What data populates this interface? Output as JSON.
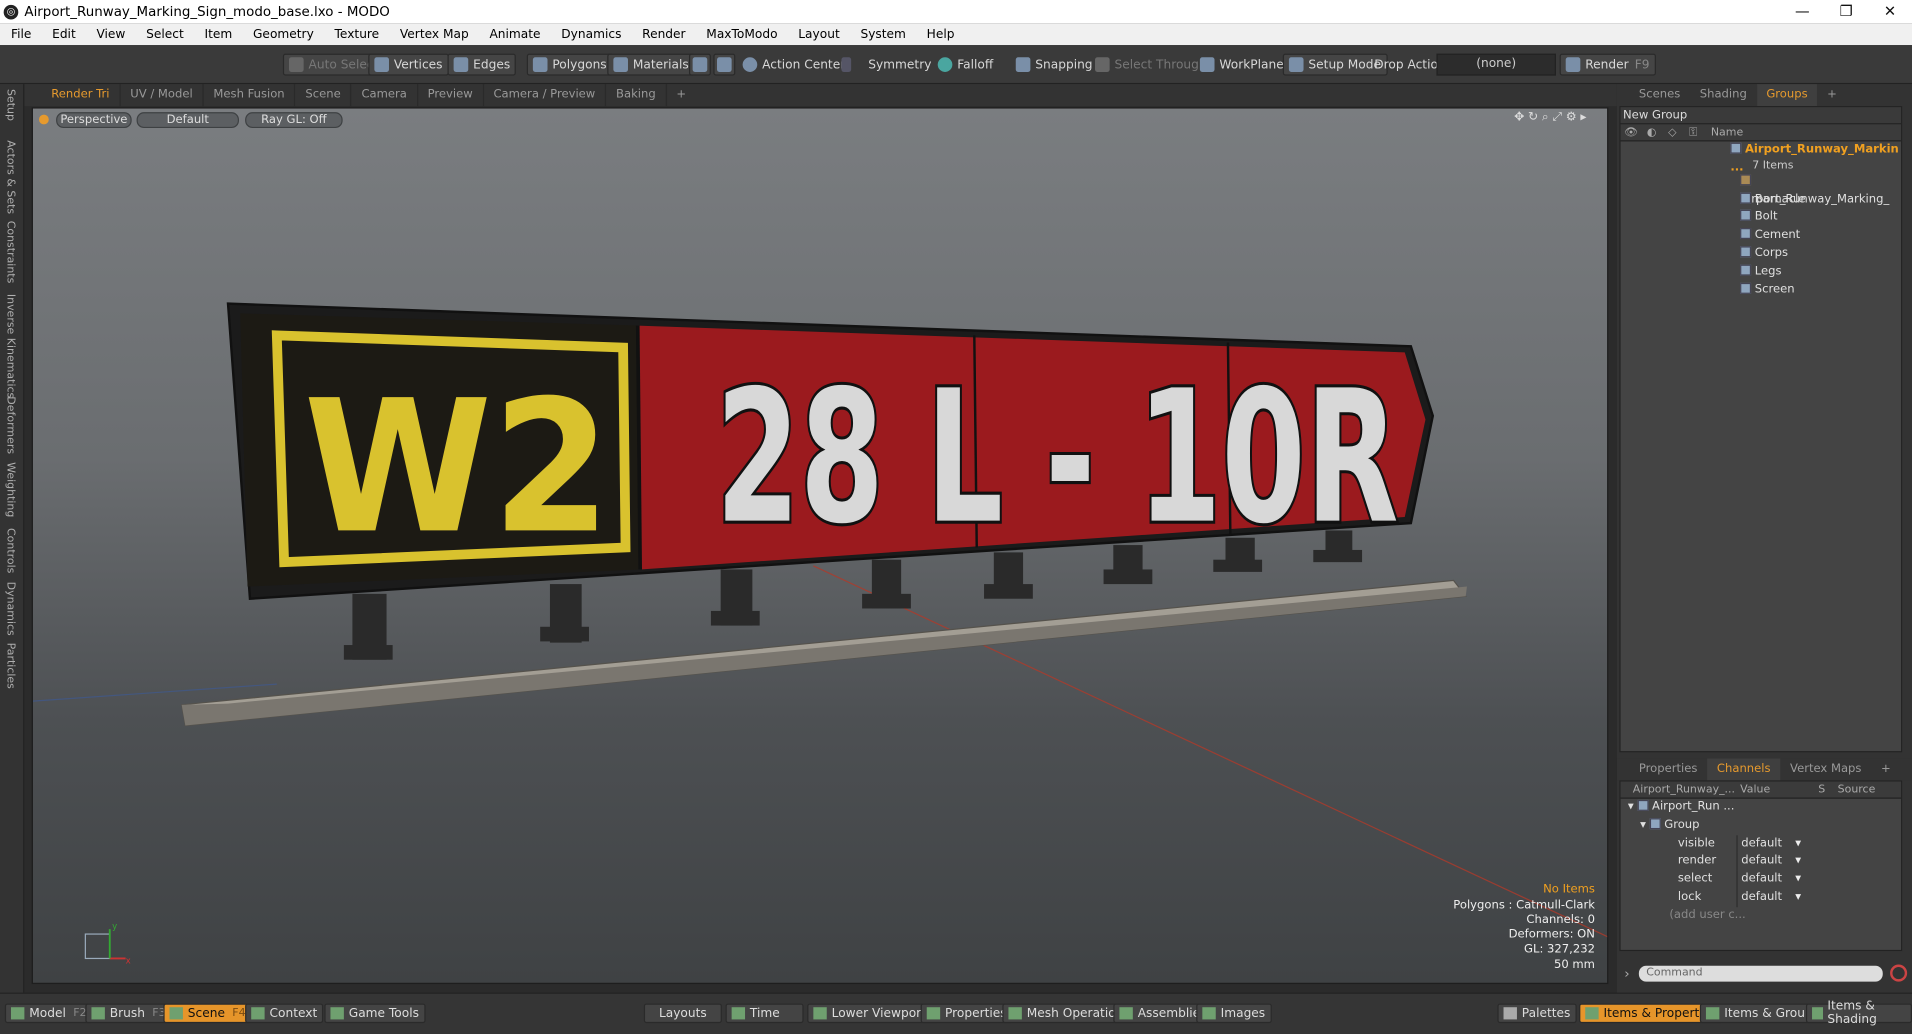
{
  "window": {
    "title": "Airport_Runway_Marking_Sign_modo_base.lxo - MODO",
    "controls": [
      "—",
      "❐",
      "✕"
    ]
  },
  "menu": [
    "File",
    "Edit",
    "View",
    "Select",
    "Item",
    "Geometry",
    "Texture",
    "Vertex Map",
    "Animate",
    "Dynamics",
    "Render",
    "MaxToModo",
    "Layout",
    "System",
    "Help"
  ],
  "toolbar": {
    "auto_select": "Auto Select",
    "vertices": "Vertices",
    "edges": "Edges",
    "polygons": "Polygons",
    "materials": "Materials",
    "action_center": "Action Center",
    "symmetry": "Symmetry",
    "falloff": "Falloff",
    "snapping": "Snapping",
    "select_through": "Select Through",
    "workplane": "WorkPlane",
    "setup_mode": "Setup Mode",
    "drop_action": "Drop Action",
    "drop_value": "(none)",
    "render": "Render",
    "render_key": "F9"
  },
  "left_tabs": [
    "Setup",
    "Actors & Sets",
    "Constraints",
    "Inverse Kinematics",
    "Deformers",
    "Weighting",
    "Controls",
    "Dynamics",
    "Particles"
  ],
  "viewport_tabs": [
    "Render Tri",
    "UV / Model",
    "Mesh Fusion",
    "Scene",
    "Camera",
    "Preview",
    "Camera / Preview",
    "Baking",
    "+"
  ],
  "viewport": {
    "view_mode": "Perspective",
    "shading": "Default",
    "raygl": "Ray GL: Off",
    "sign": {
      "left_label": "W2",
      "right_label": "28 L - 10R"
    },
    "info": {
      "status": "No Items",
      "polygons": "Polygons : Catmull-Clark",
      "channels": "Channels: 0",
      "deformers": "Deformers: ON",
      "gl": "GL: 327,232",
      "lens": "50 mm"
    },
    "axis": {
      "x": "x",
      "y": "y"
    }
  },
  "right_tabs": [
    "Scenes",
    "Shading",
    "Groups",
    "+"
  ],
  "groups": {
    "new_group": "New Group",
    "col_name": "Name",
    "root": "Airport_Runway_Markin ...",
    "root_count": "7 Items",
    "items": [
      "Airport_Runway_Marking_ ...",
      "Barnacle",
      "Bolt",
      "Cement",
      "Corps",
      "Legs",
      "Screen"
    ]
  },
  "props_tabs": [
    "Properties",
    "Channels",
    "Vertex Maps",
    "+"
  ],
  "channels": {
    "col_item": "Airport_Runway_...",
    "col_value": "Value",
    "col_s": "S",
    "col_source": "Source",
    "item": "Airport_Run ...",
    "group": "Group",
    "rows": [
      {
        "name": "visible",
        "value": "default"
      },
      {
        "name": "render",
        "value": "default"
      },
      {
        "name": "select",
        "value": "default"
      },
      {
        "name": "lock",
        "value": "default"
      }
    ],
    "add_user": "(add user c..."
  },
  "command_placeholder": "Command",
  "bottom": {
    "model": "Model",
    "model_key": "F2",
    "brush": "Brush",
    "brush_key": "F3",
    "scene": "Scene",
    "scene_key": "F4",
    "context": "Context",
    "game_tools": "Game Tools",
    "layouts": "Layouts",
    "time": "Time",
    "lower_viewports": "Lower Viewports",
    "properties": "Properties",
    "mesh_operations": "Mesh Operations",
    "assemblies": "Assemblies",
    "images": "Images",
    "palettes": "Palettes",
    "items_properties": "Items & Properties",
    "items_groups": "Items & Groups",
    "items_shading": "Items & Shading"
  },
  "colors": {
    "accent": "#e69a2e",
    "sign_red": "#9b1a1e",
    "sign_yellow": "#d9c22e"
  }
}
